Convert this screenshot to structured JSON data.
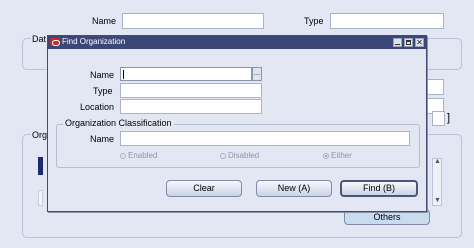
{
  "background": {
    "name_label": "Name",
    "type_label": "Type",
    "dates_label": "Dat",
    "organizations_label": "Org",
    "others_button": "Others"
  },
  "dialog": {
    "title": "Find Organization",
    "name_label": "Name",
    "type_label": "Type",
    "location_label": "Location",
    "classification_group": "Organization Classification",
    "class_name_label": "Name",
    "radio_enabled": "Enabled",
    "radio_disabled": "Disabled",
    "radio_either": "Either",
    "lov_button": "...",
    "clear_button": "Clear",
    "new_button": "New (A)",
    "find_button": "Find (B)"
  },
  "colors": {
    "titlebar": "#3b4776",
    "canvas": "#e3e7f3",
    "oracle_icon": "#c22d2d"
  }
}
